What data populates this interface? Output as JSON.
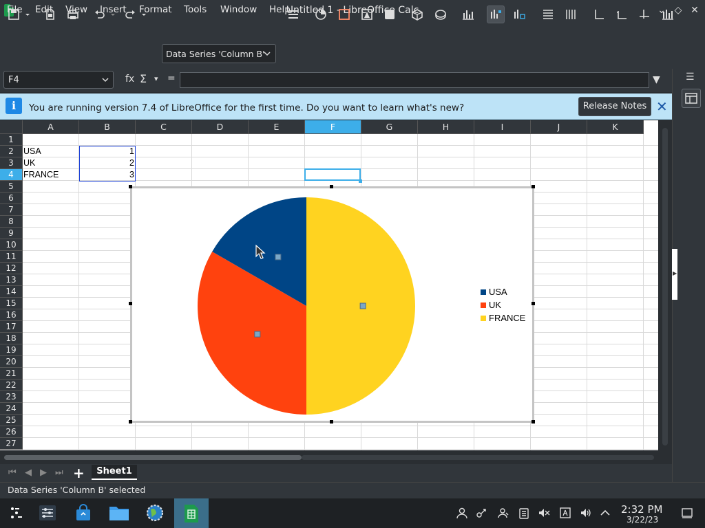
{
  "window": {
    "title": "Untitled 1 - LibreOffice Calc",
    "minimize": "⌄",
    "maximize": "◇",
    "close": "✕"
  },
  "menu": [
    "File",
    "Edit",
    "View",
    "Insert",
    "Format",
    "Tools",
    "Window",
    "Help"
  ],
  "toolbar": {
    "series_select": "Data Series 'Column B'"
  },
  "formula": {
    "cell_ref": "F4",
    "fx": "fx",
    "sigma": "Σ",
    "equals": "=",
    "value": ""
  },
  "infobar": {
    "message": "You are running version 7.4 of LibreOffice for the first time. Do you want to learn what's new?",
    "button": "Release Notes",
    "close": "✕"
  },
  "columns": [
    "A",
    "B",
    "C",
    "D",
    "E",
    "F",
    "G",
    "H",
    "I",
    "J",
    "K"
  ],
  "rows": [
    "1",
    "2",
    "3",
    "4",
    "5",
    "6",
    "7",
    "8",
    "9",
    "10",
    "11",
    "12",
    "13",
    "14",
    "15",
    "16",
    "17",
    "18",
    "19",
    "20",
    "21",
    "22",
    "23",
    "24",
    "25",
    "26",
    "27"
  ],
  "cells": [
    {
      "label": "USA",
      "value": "1"
    },
    {
      "label": "UK",
      "value": "2"
    },
    {
      "label": "FRANCE",
      "value": "3"
    }
  ],
  "chart_data": {
    "type": "pie",
    "categories": [
      "USA",
      "UK",
      "FRANCE"
    ],
    "values": [
      1,
      2,
      3
    ],
    "colors": [
      "#004586",
      "#ff420e",
      "#ffd320"
    ],
    "legend": "right"
  },
  "sheet_tabs": {
    "active": "Sheet1",
    "add": "+"
  },
  "status": {
    "text": "Data Series 'Column B' selected"
  },
  "clock": {
    "time": "2:32 PM",
    "date": "3/22/23"
  }
}
